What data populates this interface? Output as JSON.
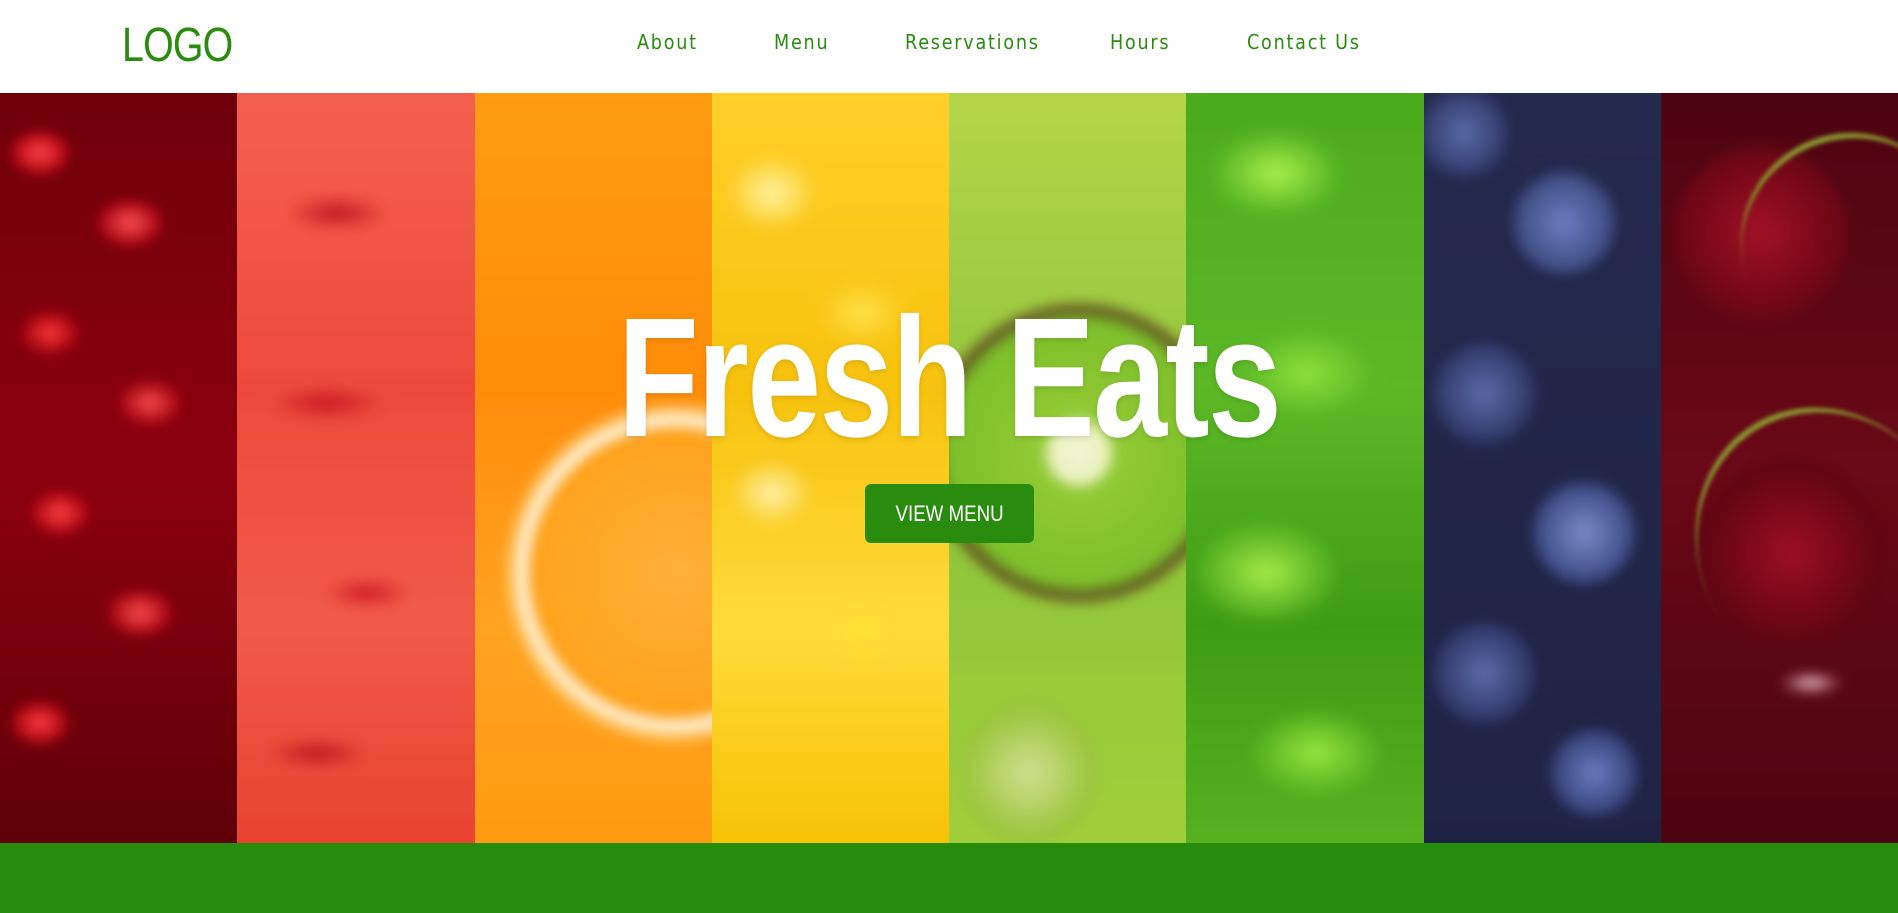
{
  "header": {
    "logo": "LOGO",
    "nav": [
      {
        "label": "About"
      },
      {
        "label": "Menu"
      },
      {
        "label": "Reservations"
      },
      {
        "label": "Hours"
      },
      {
        "label": "Contact Us"
      }
    ]
  },
  "hero": {
    "title": "Fresh Eats",
    "cta_label": "VIEW MENU",
    "background_stripes": [
      "pomegranate",
      "watermelon",
      "orange",
      "pineapple",
      "kiwi",
      "lettuce",
      "blueberry",
      "cherry"
    ]
  },
  "colors": {
    "brand_green": "#2a8c0e",
    "footer_green": "#268c0c",
    "header_background": "#ffffff",
    "title_text": "#ffffff"
  }
}
